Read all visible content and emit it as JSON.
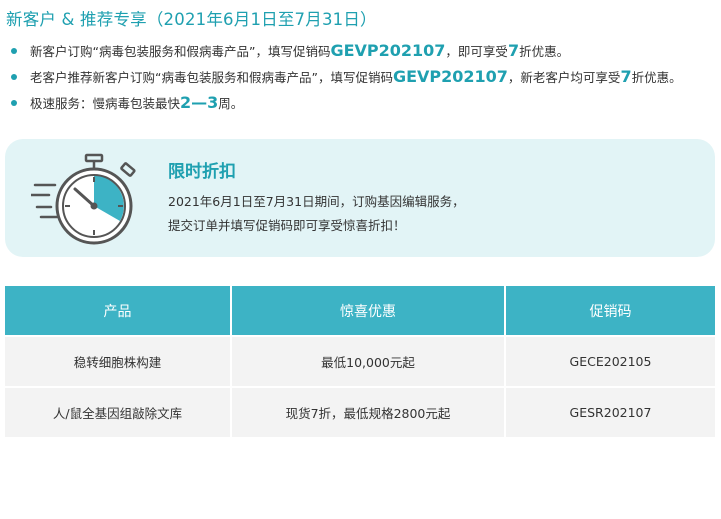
{
  "header": {
    "title": "新客户 & 推荐专享（2021年6月1日至7月31日）"
  },
  "bullets": [
    {
      "before": "新客户订购“病毒包装服务和假病毒产品”，填写促销码",
      "code": "GEVP202107",
      "middle": "，即可享受",
      "highlight": "7",
      "after": "折优惠。"
    },
    {
      "before": "老客户推荐新客户订购“病毒包装服务和假病毒产品”，填写促销码",
      "code": "GEVP202107",
      "middle": "，新老客户均可享受",
      "highlight": "7",
      "after": "折优惠。"
    },
    {
      "before": "极速服务：慢病毒包装最快",
      "highlight": "2—3",
      "after": "周。"
    }
  ],
  "banner": {
    "icon": "stopwatch-icon",
    "title": "限时折扣",
    "line1": "2021年6月1日至7月31日期间，订购基因编辑服务，",
    "line2": "提交订单并填写促销码即可享受惊喜折扣！"
  },
  "table": {
    "headers": [
      "产品",
      "惊喜优惠",
      "促销码"
    ],
    "rows": [
      [
        "稳转细胞株构建",
        "最低10,000元起",
        "GECE202105"
      ],
      [
        "人/鼠全基因组敲除文库",
        "现货7折，最低规格2800元起",
        "GESR202107"
      ]
    ]
  },
  "colors": {
    "accent": "#1fa0b0",
    "table_header": "#3db3c5",
    "banner_bg": "#e2f4f6",
    "row_bg": "#f3f3f3"
  }
}
